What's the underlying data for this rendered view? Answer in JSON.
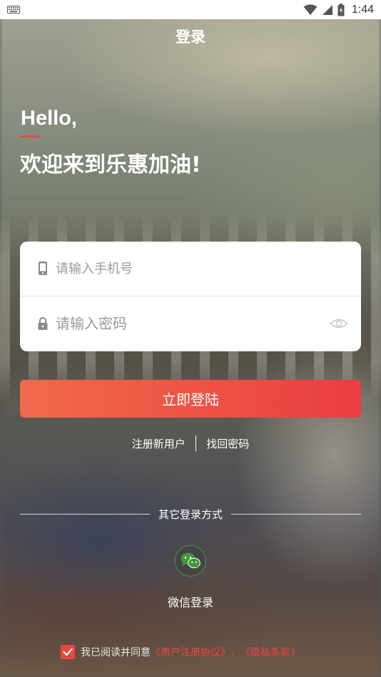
{
  "status_bar": {
    "time": "1:44",
    "icons": [
      "keyboard-icon",
      "wifi-icon",
      "signal-icon",
      "battery-icon"
    ]
  },
  "header": {
    "title": "登录"
  },
  "greeting": {
    "hello": "Hello,",
    "welcome": "欢迎来到乐惠加油!"
  },
  "form": {
    "phone": {
      "placeholder": "请输入手机号",
      "value": "",
      "icon": "phone-icon"
    },
    "password": {
      "placeholder": "请输入密码",
      "value": "",
      "icon": "lock-icon",
      "toggle_icon": "eye-icon"
    }
  },
  "login_button": {
    "label": "立即登陆"
  },
  "links": {
    "register": "注册新用户",
    "recover": "找回密码"
  },
  "other_login": {
    "heading": "其它登录方式",
    "wechat_label": "微信登录"
  },
  "agreement": {
    "checked": true,
    "prefix": "我已阅读并同意",
    "user_agreement": "《用户注册协议》",
    "separator": "，",
    "privacy": "《隐私条款》"
  },
  "colors": {
    "accent": "#E8483F",
    "button_start": "#F06A4C",
    "button_end": "#EA3D42",
    "wechat": "#3D9A35"
  }
}
